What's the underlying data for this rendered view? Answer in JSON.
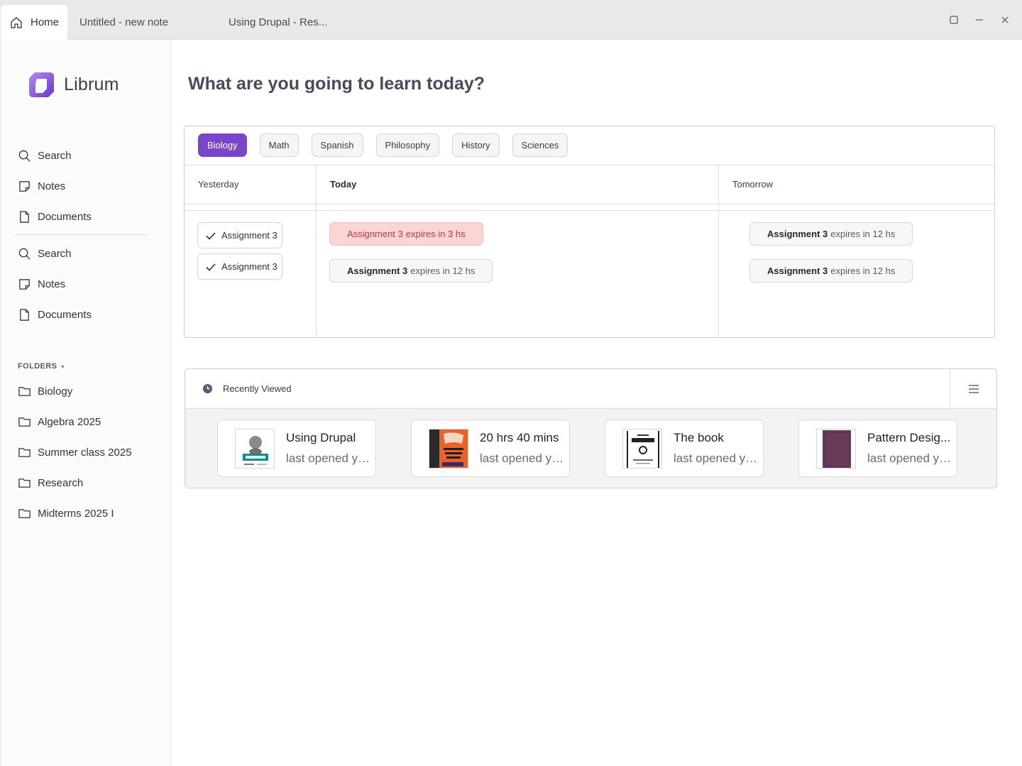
{
  "titlebar": {
    "tabs": [
      {
        "label": "Home"
      },
      {
        "label": "Untitled - new note"
      },
      {
        "label": "Using Drupal - Res..."
      }
    ]
  },
  "sidebar": {
    "app_name": "Librum",
    "nav_primary": [
      {
        "label": "Search",
        "icon": "search-icon"
      },
      {
        "label": "Notes",
        "icon": "note-icon"
      },
      {
        "label": "Documents",
        "icon": "document-icon"
      }
    ],
    "nav_secondary": [
      {
        "label": "Search",
        "icon": "search-icon"
      },
      {
        "label": "Notes",
        "icon": "note-icon"
      },
      {
        "label": "Documents",
        "icon": "document-icon"
      }
    ],
    "folders_title": "FOLDERS",
    "folders": [
      {
        "label": "Biology"
      },
      {
        "label": "Algebra 2025"
      },
      {
        "label": "Summer class 2025"
      },
      {
        "label": "Research"
      },
      {
        "label": "Midterms 2025 I"
      }
    ]
  },
  "main": {
    "heading": "What are you going to learn today?",
    "subjects": [
      {
        "label": "Biology",
        "active": true
      },
      {
        "label": "Math"
      },
      {
        "label": "Spanish"
      },
      {
        "label": "Philosophy"
      },
      {
        "label": "History"
      },
      {
        "label": "Sciences"
      }
    ],
    "columns": {
      "yesterday": "Yesterday",
      "today": "Today",
      "tomorrow": "Tomorrow"
    },
    "yesterday_tasks": [
      {
        "label": "Assignment 3"
      },
      {
        "label": "Assignment 3"
      }
    ],
    "today_tasks": [
      {
        "name": "Assignment 3",
        "status": "expires in 3 hs"
      },
      {
        "name": "Assignment 3",
        "status": "expires in 12 hs"
      }
    ],
    "tomorrow_tasks": [
      {
        "name": "Assignment 3",
        "status": "expires in 12 hs"
      },
      {
        "name": "Assignment 3",
        "status": "expires in 12 hs"
      }
    ],
    "recent": {
      "title": "Recently Viewed",
      "items": [
        {
          "title": "Using Drupal",
          "subtitle": "last opened ye..."
        },
        {
          "title": "20 hrs 40 mins",
          "subtitle": "last opened ye..."
        },
        {
          "title": "The book",
          "subtitle": "last opened ye..."
        },
        {
          "title": "Pattern Desig...",
          "subtitle": "last opened ye..."
        }
      ]
    }
  },
  "colors": {
    "accent": "#7b45c9",
    "urgent_bg": "#fbd4d4",
    "urgent_text": "#c23a3a"
  }
}
